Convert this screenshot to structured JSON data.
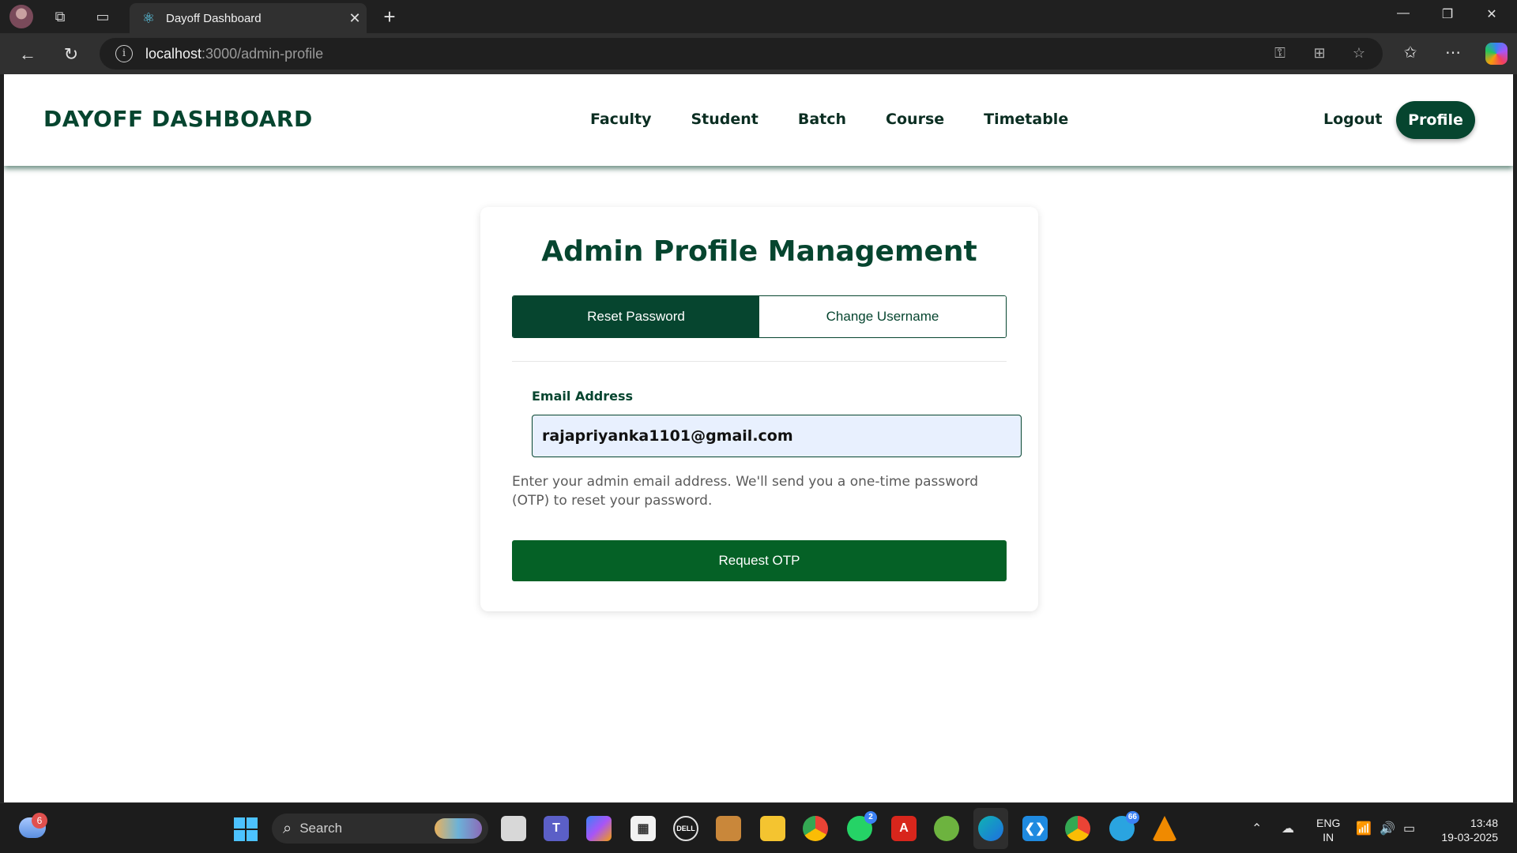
{
  "browser": {
    "tab_title": "Dayoff Dashboard",
    "url_host": "localhost",
    "url_path": ":3000/admin-profile",
    "icons": [
      "profile-avatar-icon",
      "workspaces-icon",
      "vertical-tabs-icon",
      "react-favicon-icon",
      "close-tab-icon",
      "new-tab-icon",
      "minimize-icon",
      "restore-icon",
      "close-window-icon",
      "back-icon",
      "refresh-icon",
      "site-info-icon",
      "key-icon",
      "extensions-icon",
      "favorite-star-icon",
      "favorites-icon",
      "more-icon",
      "copilot-icon"
    ]
  },
  "app": {
    "brand": "DAYOFF DASHBOARD",
    "nav": [
      "Faculty",
      "Student",
      "Batch",
      "Course",
      "Timetable"
    ],
    "logout": "Logout",
    "profile": "Profile",
    "accent": "#06452f"
  },
  "card": {
    "title": "Admin Profile Management",
    "tabs": {
      "active": "Reset Password",
      "inactive": "Change Username"
    },
    "email_label": "Email Address",
    "email_value": "rajapriyanka1101@gmail.com",
    "hint": "Enter your admin email address. We'll send you a one-time password (OTP) to reset your password.",
    "submit": "Request OTP",
    "submit_color": "#056126"
  },
  "taskbar": {
    "weather_badge": "6",
    "search_text": "Search",
    "whatsapp_badge": "2",
    "telegram_badge": "66",
    "lang_line1": "ENG",
    "lang_line2": "IN",
    "time": "13:48",
    "date": "19-03-2025"
  }
}
